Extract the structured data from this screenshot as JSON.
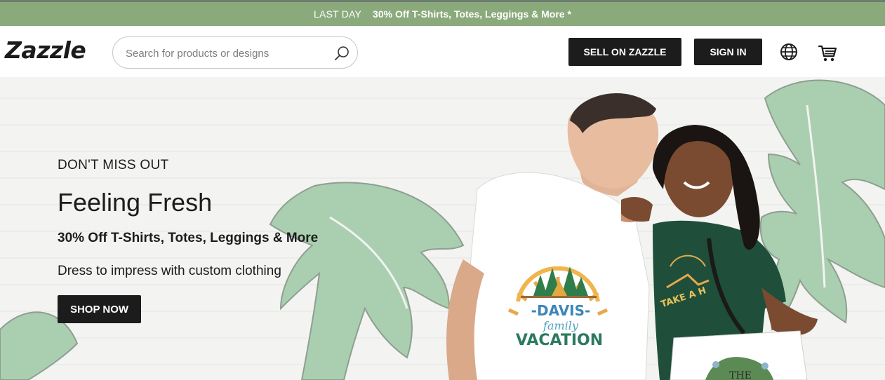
{
  "promo": {
    "last_day": "LAST DAY",
    "offer": "30% Off T-Shirts, Totes, Leggings & More *"
  },
  "header": {
    "logo": "Zazzle",
    "search": {
      "placeholder": "Search for products or designs",
      "value": ""
    },
    "sell_label": "SELL ON ZAZZLE",
    "signin_label": "SIGN IN",
    "icons": {
      "search": "search-icon",
      "globe": "globe-icon",
      "cart": "cart-icon"
    }
  },
  "hero": {
    "eyebrow": "DON'T MISS OUT",
    "headline": "Feeling Fresh",
    "subhead": "30% Off T-Shirts, Totes, Leggings & More",
    "description": "Dress to impress with custom clothing",
    "cta_label": "SHOP NOW",
    "shirt_graphic": {
      "line1": "-DAVIS-",
      "line2": "family",
      "line3": "VACATION"
    },
    "shirt2_text": "TAKE A H",
    "tote_text": "THE"
  },
  "colors": {
    "promo_bg": "#8aaa7b",
    "button_dark": "#1c1c1c",
    "leaf_green": "#a9cfb0",
    "hero_bg": "#f3f3f1"
  }
}
